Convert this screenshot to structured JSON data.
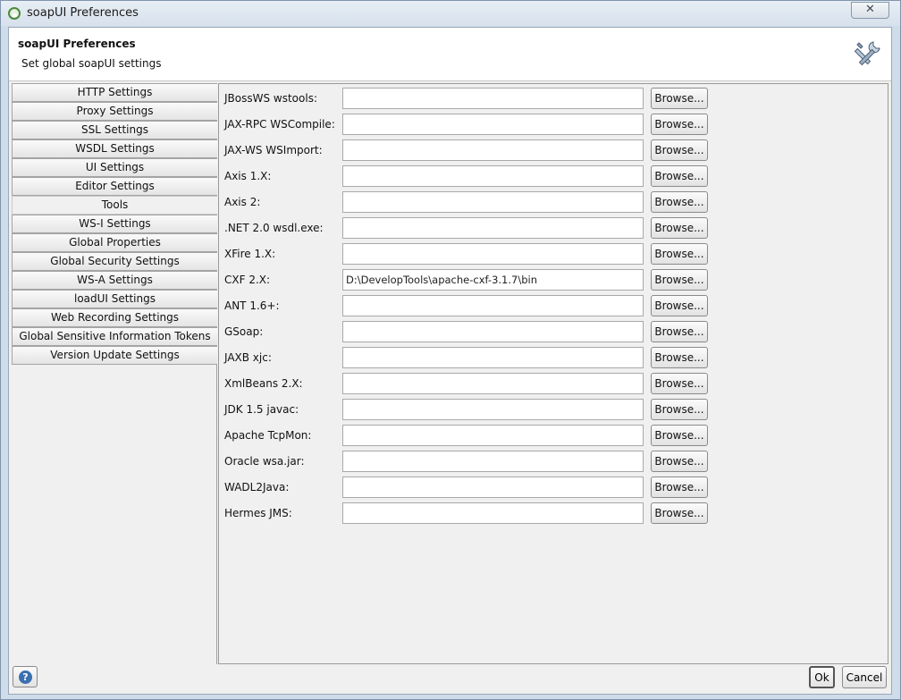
{
  "window": {
    "title": "soapUI Preferences",
    "close_glyph": "✕"
  },
  "header": {
    "title": "soapUI Preferences",
    "subtitle": "Set global soapUI settings",
    "icon": "tools-icon"
  },
  "sidebar": {
    "items": [
      {
        "label": "HTTP Settings",
        "active": false
      },
      {
        "label": "Proxy Settings",
        "active": false
      },
      {
        "label": "SSL Settings",
        "active": false
      },
      {
        "label": "WSDL Settings",
        "active": false
      },
      {
        "label": "UI Settings",
        "active": false
      },
      {
        "label": "Editor Settings",
        "active": false
      },
      {
        "label": "Tools",
        "active": true
      },
      {
        "label": "WS-I Settings",
        "active": false
      },
      {
        "label": "Global Properties",
        "active": false
      },
      {
        "label": "Global Security Settings",
        "active": false
      },
      {
        "label": "WS-A Settings",
        "active": false
      },
      {
        "label": "loadUI Settings",
        "active": false
      },
      {
        "label": "Web Recording Settings",
        "active": false
      },
      {
        "label": "Global Sensitive Information Tokens",
        "active": false
      },
      {
        "label": "Version Update Settings",
        "active": false
      }
    ]
  },
  "tools": {
    "browse_label": "Browse...",
    "rows": [
      {
        "label": "JBossWS wstools:",
        "value": ""
      },
      {
        "label": "JAX-RPC WSCompile:",
        "value": ""
      },
      {
        "label": "JAX-WS WSImport:",
        "value": ""
      },
      {
        "label": "Axis 1.X:",
        "value": ""
      },
      {
        "label": "Axis 2:",
        "value": ""
      },
      {
        "label": ".NET 2.0 wsdl.exe:",
        "value": ""
      },
      {
        "label": "XFire 1.X:",
        "value": ""
      },
      {
        "label": "CXF 2.X:",
        "value": "D:\\DevelopTools\\apache-cxf-3.1.7\\bin"
      },
      {
        "label": "ANT 1.6+:",
        "value": ""
      },
      {
        "label": "GSoap:",
        "value": ""
      },
      {
        "label": "JAXB xjc:",
        "value": ""
      },
      {
        "label": "XmlBeans 2.X:",
        "value": ""
      },
      {
        "label": "JDK 1.5 javac:",
        "value": ""
      },
      {
        "label": "Apache TcpMon:",
        "value": ""
      },
      {
        "label": "Oracle wsa.jar:",
        "value": ""
      },
      {
        "label": "WADL2Java:",
        "value": ""
      },
      {
        "label": "Hermes JMS:",
        "value": ""
      }
    ]
  },
  "footer": {
    "help_glyph": "?",
    "ok_label": "Ok",
    "cancel_label": "Cancel"
  }
}
